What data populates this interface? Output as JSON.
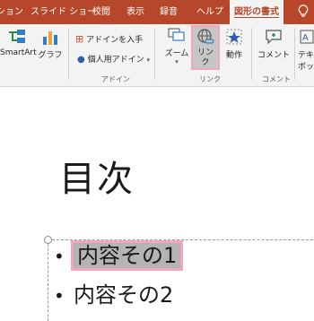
{
  "tabs": [
    {
      "label": "ション",
      "active": false
    },
    {
      "label": "スライド ショー",
      "active": false
    },
    {
      "label": "校閲",
      "active": false
    },
    {
      "label": "表示",
      "active": false
    },
    {
      "label": "録音",
      "active": false
    },
    {
      "label": "ヘルプ",
      "active": false
    },
    {
      "label": "図形の書式",
      "active": true
    }
  ],
  "tab_bar_color": "#b7472a",
  "ribbon": {
    "smartart_label": "SmartArt",
    "graph_label": "グラフ",
    "get_addins_label": "アドインを入手",
    "my_addins_label": "個人用アドイン",
    "addins_group_label": "アドイン",
    "zoom_label": "ズーム",
    "link_label_line1": "リン",
    "link_label_line2": "ク",
    "action_label": "動作",
    "link_group_label": "リンク",
    "comment_label": "コメント",
    "comment_group_label": "コメント",
    "text_label_line1": "テキ",
    "text_label_line2": "ボッ"
  },
  "slide": {
    "title": "目次",
    "bullets": [
      "内容その1",
      "内容その2"
    ]
  },
  "highlight_color": "#f3a7bf"
}
